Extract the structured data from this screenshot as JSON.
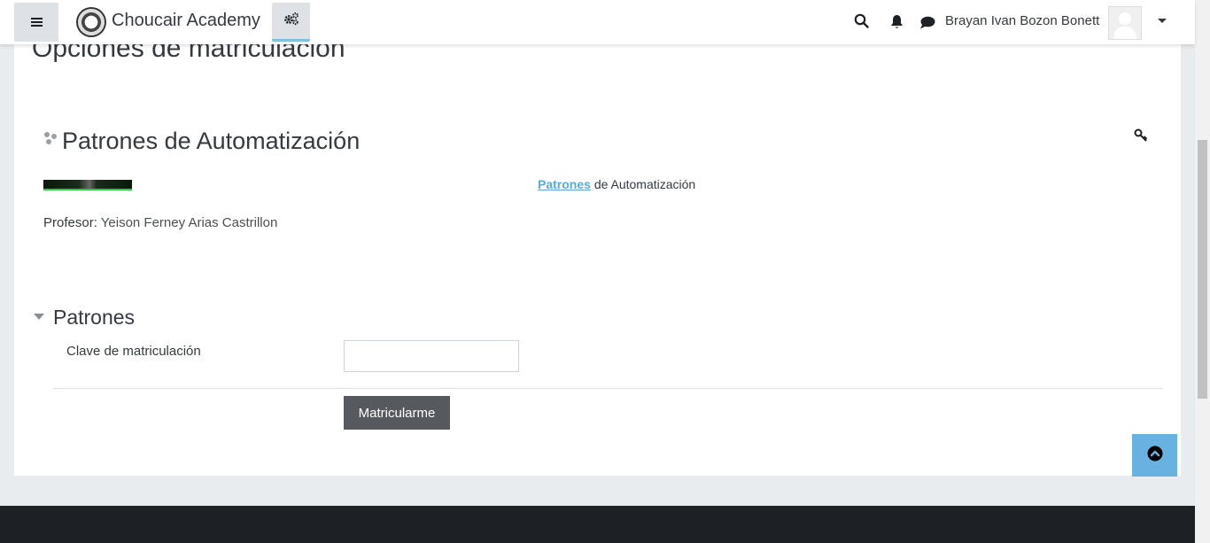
{
  "header": {
    "brand": "Choucair Academy",
    "username": "Brayan Ivan Bozon Bonett"
  },
  "page": {
    "title": "Opciones de matriculación"
  },
  "course": {
    "title": "Patrones de Automatización",
    "summary_link": "Patrones",
    "summary_rest": "de Automatización",
    "teacher_label": "Profesor:",
    "teacher_name": "Yeison Ferney Arias Castrillon"
  },
  "enrol": {
    "section_title": "Patrones",
    "key_label": "Clave de matriculación",
    "key_value": "",
    "submit_label": "Matricularme"
  },
  "icons": {
    "menu": "hamburger-icon",
    "admin": "gears-icon",
    "search": "search-icon",
    "notifications": "bell-icon",
    "messages": "chat-icon",
    "user_menu": "caret-down-icon",
    "course": "course-icon",
    "key": "key-icon",
    "back_to_top": "arrow-up-icon"
  },
  "colors": {
    "accent": "#67b2e0",
    "link": "#5aa9d6",
    "button": "#565a5e",
    "footer": "#1d2125"
  }
}
